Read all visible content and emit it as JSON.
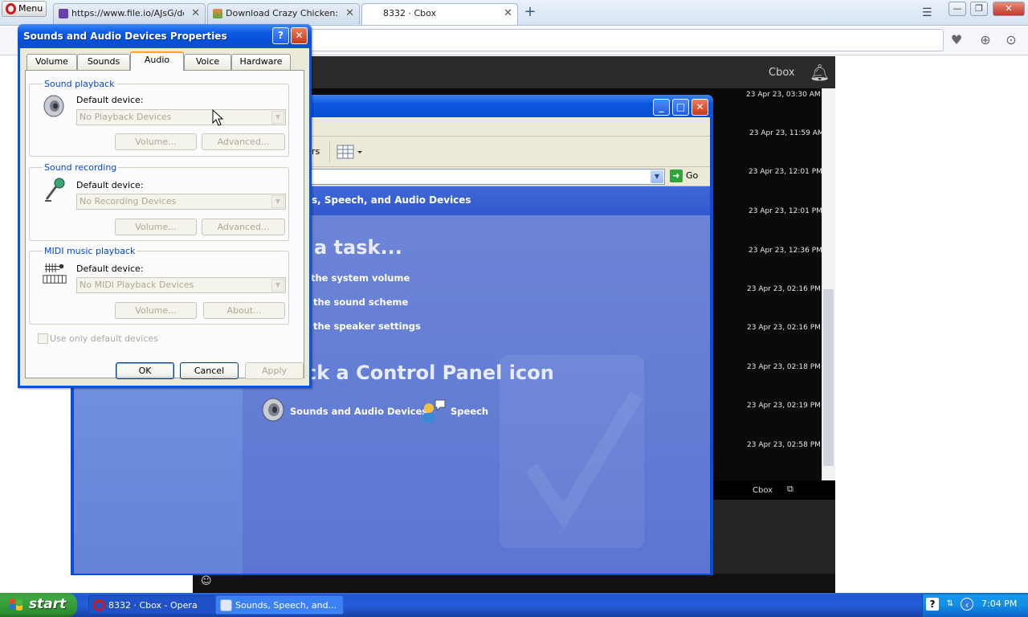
{
  "browser": {
    "menu_label": "Menu",
    "tabs": [
      {
        "label": "https://www.file.io/AJsG/do",
        "favicon_color": "#6a3fb0"
      },
      {
        "label": "Download Crazy Chicken: The",
        "favicon_color": "#4a7a2a"
      },
      {
        "label": "8332 · Cbox",
        "favicon_color": ""
      }
    ],
    "new_tab": "+",
    "close_glyph": "✕"
  },
  "site": {
    "title": "Cbox",
    "bell_icon": "bell-icon",
    "timestamps": [
      "23 Apr 23, 03:30 AM",
      "23 Apr 23, 11:59 AM",
      "23 Apr 23, 12:01 PM",
      "23 Apr 23, 12:01 PM",
      "23 Apr 23, 12:36 PM",
      "23 Apr 23, 02:16 PM",
      "23 Apr 23, 02:16 PM",
      "23 Apr 23, 02:18 PM",
      "23 Apr 23, 02:19 PM",
      "23 Apr 23, 02:58 PM"
    ],
    "footer_label": "Cbox",
    "emoji_glyph": "☺"
  },
  "control_panel": {
    "toolbar_fragment": "rs",
    "go_label": "Go",
    "header": "s, Speech, and Audio Devices",
    "pick_task": "a task...",
    "tasks": [
      "the system volume",
      "the sound scheme",
      "the speaker settings"
    ],
    "pick_icon": "ck a Control Panel icon",
    "icons": [
      {
        "label": "Sounds and Audio Devices"
      },
      {
        "label": "Speech"
      }
    ]
  },
  "dialog": {
    "title": "Sounds and Audio Devices Properties",
    "help": "?",
    "tabs": [
      "Volume",
      "Sounds",
      "Audio",
      "Voice",
      "Hardware"
    ],
    "active_tab": "Audio",
    "groups": [
      {
        "label": "Sound playback",
        "device_label": "Default device:",
        "device_value": "No Playback Devices",
        "btn1": "Volume...",
        "btn2": "Advanced..."
      },
      {
        "label": "Sound recording",
        "device_label": "Default device:",
        "device_value": "No Recording Devices",
        "btn1": "Volume...",
        "btn2": "Advanced..."
      },
      {
        "label": "MIDI music playback",
        "device_label": "Default device:",
        "device_value": "No MIDI Playback Devices",
        "btn1": "Volume...",
        "btn2": "About..."
      }
    ],
    "checkbox_label": "Use only default devices",
    "ok": "OK",
    "cancel": "Cancel",
    "apply": "Apply"
  },
  "taskbar": {
    "start": "start",
    "tasks": [
      {
        "label": "8332 · Cbox - Opera"
      },
      {
        "label": "Sounds, Speech, and..."
      }
    ],
    "clock": "7:04 PM"
  },
  "colors": {
    "xp_blue": "#0a55e0",
    "start_green": "#3ea842",
    "dialog_face": "#ece9d8",
    "group_label": "#0046d5"
  }
}
